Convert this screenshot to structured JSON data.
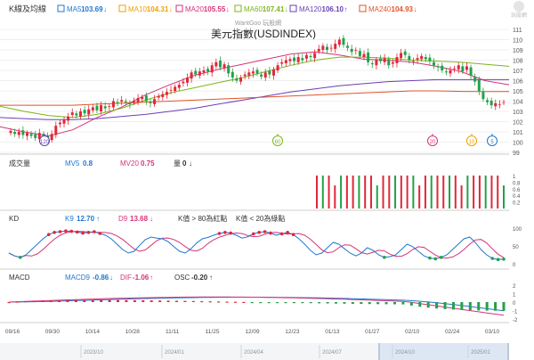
{
  "header": {
    "indicator_label": "K線及均線",
    "ma": [
      {
        "label": "MA5",
        "value": "103.69",
        "arrow": "↓",
        "color": "#1f77d0"
      },
      {
        "label": "MA10",
        "value": "104.31",
        "arrow": "↓",
        "color": "#f0a000"
      },
      {
        "label": "MA20",
        "value": "105.55",
        "arrow": "↓",
        "color": "#d6337a"
      },
      {
        "label": "MA60",
        "value": "107.41",
        "arrow": "↓",
        "color": "#7cb518"
      },
      {
        "label": "MA120",
        "value": "106.10",
        "arrow": "↑",
        "color": "#6a3fb5"
      },
      {
        "label": "MA240",
        "value": "104.93",
        "arrow": "↓",
        "color": "#e0542a"
      }
    ],
    "watermark": "WantGoo 玩股網",
    "logo_text": "玩股網"
  },
  "chart_data": {
    "type": "candlestick",
    "title": "美元指數(USDINDEX)",
    "price_axis": {
      "ticks": [
        "111",
        "110",
        "109",
        "108",
        "107",
        "106",
        "105",
        "104",
        "103",
        "102",
        "101",
        "100",
        "99"
      ],
      "range": [
        99,
        111
      ]
    },
    "x_tick_labels": [
      "09/16",
      "09/30",
      "10/14",
      "10/28",
      "11/11",
      "11/25",
      "12/09",
      "12/23",
      "01/13",
      "01/27",
      "02/10",
      "02/24",
      "03/10"
    ],
    "candles_close": [
      101.1,
      100.8,
      101.0,
      100.7,
      100.9,
      100.6,
      100.4,
      100.9,
      100.5,
      100.3,
      100.8,
      101.6,
      101.9,
      102.2,
      102.5,
      102.9,
      102.6,
      103.0,
      102.8,
      103.2,
      103.4,
      103.1,
      103.6,
      103.3,
      103.5,
      104.0,
      103.8,
      104.1,
      103.9,
      103.7,
      104.0,
      104.3,
      104.4,
      104.0,
      103.8,
      104.2,
      104.5,
      104.7,
      104.9,
      105.1,
      105.4,
      105.6,
      105.9,
      106.3,
      106.8,
      106.6,
      106.9,
      107.0,
      106.9,
      107.5,
      107.8,
      107.3,
      107.6,
      106.7,
      106.3,
      106.0,
      106.3,
      106.6,
      106.8,
      106.9,
      106.7,
      106.4,
      106.8,
      106.6,
      107.1,
      107.5,
      107.8,
      108.0,
      108.1,
      107.9,
      108.3,
      108.0,
      108.5,
      108.3,
      108.7,
      109.1,
      109.4,
      109.0,
      109.2,
      109.6,
      110.0,
      109.5,
      109.2,
      108.8,
      109.0,
      108.4,
      108.6,
      107.8,
      107.6,
      108.0,
      107.9,
      108.2,
      107.5,
      107.8,
      108.3,
      108.7,
      108.5,
      108.0,
      107.9,
      108.2,
      108.4,
      108.1,
      107.9,
      107.5,
      107.3,
      107.0,
      106.8,
      107.0,
      107.2,
      107.5,
      106.9,
      107.4,
      106.5,
      105.9,
      105.0,
      104.2,
      103.9,
      103.6,
      103.8,
      103.7,
      103.9
    ],
    "ma_series": [
      {
        "name": "MA20",
        "color": "#d6337a",
        "points": [
          101.5,
          101.0,
          100.6,
          101.2,
          102.4,
          103.4,
          104.6,
          105.6,
          106.5,
          107.1,
          107.6,
          108.1,
          108.6,
          108.8,
          108.5,
          108.1,
          108.0,
          107.8,
          107.4,
          106.9,
          106.0,
          105.6
        ]
      },
      {
        "name": "MA60",
        "color": "#7cb518",
        "points": [
          103.5,
          103.0,
          102.6,
          102.4,
          102.7,
          103.3,
          104.1,
          104.8,
          105.3,
          105.8,
          106.3,
          106.9,
          107.5,
          108.0,
          108.3,
          108.3,
          108.2,
          108.0,
          107.9,
          107.8,
          107.6,
          107.4
        ]
      },
      {
        "name": "MA120",
        "color": "#6a3fb5",
        "points": [
          102.4,
          102.3,
          102.2,
          102.2,
          102.3,
          102.5,
          102.7,
          103.0,
          103.3,
          103.7,
          104.1,
          104.5,
          104.9,
          105.2,
          105.5,
          105.7,
          105.9,
          106.0,
          106.1,
          106.1,
          106.1,
          106.1
        ]
      },
      {
        "name": "MA240",
        "color": "#e0542a",
        "points": [
          103.6,
          103.6,
          103.6,
          103.6,
          103.7,
          103.8,
          103.9,
          104.0,
          104.1,
          104.2,
          104.3,
          104.4,
          104.5,
          104.6,
          104.7,
          104.8,
          104.9,
          105.0,
          105.0,
          104.95,
          104.93,
          104.93
        ]
      }
    ],
    "markers": [
      "120",
      "60",
      "20",
      "10",
      "5"
    ],
    "volume": {
      "label": "成交量",
      "mv5_label": "MV5",
      "mv5": "0.8",
      "mv20_label": "MV20",
      "mv20": "0.75",
      "qty_label": "量",
      "qty": "0",
      "qty_arrow": "↓",
      "ticks": [
        "1",
        "0.8",
        "0.6",
        "0.4",
        "0.2"
      ]
    },
    "kd": {
      "label": "KD",
      "k_label": "K9",
      "k": "12.70",
      "k_arrow": "↑",
      "d_label": "D9",
      "d": "13.68",
      "d_arrow": "↓",
      "note1": "K值 > 80為紅點",
      "note2": "K值 < 20為綠點",
      "ticks": [
        "100",
        "50",
        "0"
      ]
    },
    "macd": {
      "label": "MACD",
      "macd_label": "MACD9",
      "macd": "-0.86",
      "macd_arrow": "↓",
      "dif_label": "DIF",
      "dif": "-1.06",
      "dif_arrow": "↑",
      "osc_label": "OSC",
      "osc": "-0.20",
      "osc_arrow": "↑",
      "ticks": [
        "2",
        "1",
        "0",
        "-1",
        "-2"
      ]
    },
    "range_labels": [
      "2023/10",
      "2024/01",
      "2024/04",
      "2024/07",
      "2024/10",
      "2025/01"
    ]
  }
}
